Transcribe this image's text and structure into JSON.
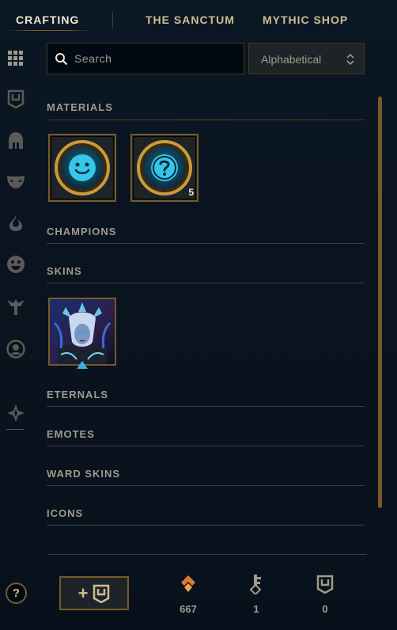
{
  "nav": {
    "tabs": [
      {
        "label": "CRAFTING",
        "active": true
      },
      {
        "label": "THE SANCTUM",
        "active": false
      },
      {
        "label": "MYTHIC SHOP",
        "active": false
      }
    ]
  },
  "sidebar": {
    "icons": [
      "grid-icon",
      "chest-icon",
      "helmet-icon",
      "mask-icon",
      "flame-icon",
      "emote-icon",
      "ward-icon",
      "profile-icon",
      "crafting-icon"
    ]
  },
  "search": {
    "placeholder": "Search",
    "value": ""
  },
  "sort": {
    "selected": "Alphabetical"
  },
  "sections": {
    "materials": "MATERIALS",
    "champions": "CHAMPIONS",
    "skins": "SKINS",
    "eternals": "ETERNALS",
    "emotes": "EMOTES",
    "ward_skins": "WARD SKINS",
    "icons": "ICONS"
  },
  "materials": [
    {
      "icon": "emote-orb-icon",
      "count": ""
    },
    {
      "icon": "mystery-orb-icon",
      "count": "5"
    }
  ],
  "skins": [
    {
      "icon": "skin-portrait"
    }
  ],
  "footer": {
    "help_label": "?",
    "add_label": "+",
    "currencies": [
      {
        "icon": "essence-icon",
        "value": "667",
        "color": "#e07a2c"
      },
      {
        "icon": "key-icon",
        "value": "1",
        "color": "#a09b8c"
      },
      {
        "icon": "chest-icon",
        "value": "0",
        "color": "#a09b8c"
      }
    ]
  },
  "colors": {
    "gold": "#785a28",
    "text": "#a09b8c",
    "accent_teal": "#0ac8b9"
  }
}
